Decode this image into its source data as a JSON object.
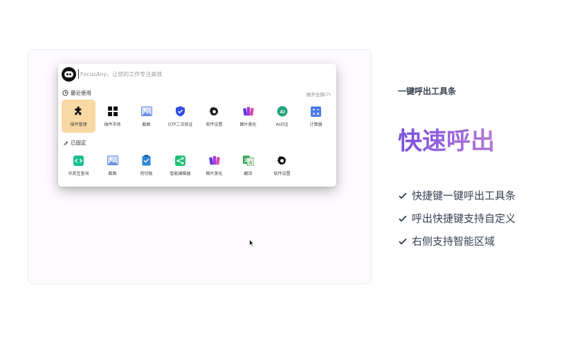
{
  "launcher": {
    "search_placeholder": "FocusAny，让您的工作专注高效",
    "recent_title": "最近使用",
    "expand_label": "展开全部(7)",
    "recent_items": [
      {
        "label": "插件管理",
        "icon": "puzzle-icon",
        "color": "#111111"
      },
      {
        "label": "插件市场",
        "icon": "grid-icon",
        "color": "#111111"
      },
      {
        "label": "截图",
        "icon": "image-icon",
        "color": "#6b8fe0"
      },
      {
        "label": "OTP二次验证",
        "icon": "shield-check-icon",
        "color": "#2f4fe6"
      },
      {
        "label": "软件设置",
        "icon": "gear-icon",
        "color": "#111111"
      },
      {
        "label": "图片美化",
        "icon": "books-icon",
        "color": "#a43ad8"
      },
      {
        "label": "AI对话",
        "icon": "ai-icon",
        "color": "#22a37c"
      },
      {
        "label": "计算器",
        "icon": "calculator-icon",
        "color": "#4a7be8"
      }
    ],
    "pinned_title": "已固定",
    "pinned_items": [
      {
        "label": "中英互查词",
        "icon": "code-icon",
        "color": "#1bbf8f"
      },
      {
        "label": "截图",
        "icon": "image-icon",
        "color": "#6b8fe0"
      },
      {
        "label": "剪切板",
        "icon": "clipboard-icon",
        "color": "#2b87d8"
      },
      {
        "label": "智能编辑器",
        "icon": "share-icon",
        "color": "#1fbf73"
      },
      {
        "label": "图片美化",
        "icon": "books-icon",
        "color": "#a43ad8"
      },
      {
        "label": "翻译",
        "icon": "translate-icon",
        "color": "#3fa85a"
      },
      {
        "label": "软件设置",
        "icon": "gear-icon",
        "color": "#111111"
      }
    ]
  },
  "hero": {
    "subtitle": "一键呼出工具条",
    "title": "快速呼出",
    "features": [
      "快捷键一键呼出工具条",
      "呼出快捷键支持自定义",
      "右侧支持智能区域"
    ]
  }
}
